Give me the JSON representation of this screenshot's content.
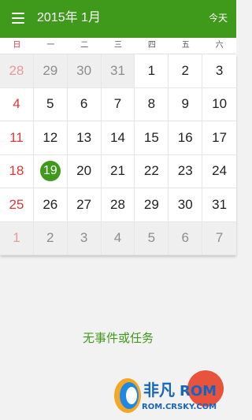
{
  "header": {
    "title": "2015年 1月",
    "today_label": "今天"
  },
  "weekdays": [
    "日",
    "一",
    "二",
    "三",
    "四",
    "五",
    "六"
  ],
  "calendar": {
    "today": "19",
    "weeks": [
      [
        "28",
        "29",
        "30",
        "31",
        "1",
        "2",
        "3"
      ],
      [
        "4",
        "5",
        "6",
        "7",
        "8",
        "9",
        "10"
      ],
      [
        "11",
        "12",
        "13",
        "14",
        "15",
        "16",
        "17"
      ],
      [
        "18",
        "19",
        "20",
        "21",
        "22",
        "23",
        "24"
      ],
      [
        "25",
        "26",
        "27",
        "28",
        "29",
        "30",
        "31"
      ],
      [
        "1",
        "2",
        "3",
        "4",
        "5",
        "6",
        "7"
      ]
    ]
  },
  "events": {
    "empty_message": "无事件或任务"
  },
  "watermark": {
    "brand": "非凡ROM",
    "url": "ROM.CRSKY.COM"
  },
  "colors": {
    "accent": "#3f9a1c",
    "sunday": "#d8393a",
    "fab": "#e8533b"
  }
}
